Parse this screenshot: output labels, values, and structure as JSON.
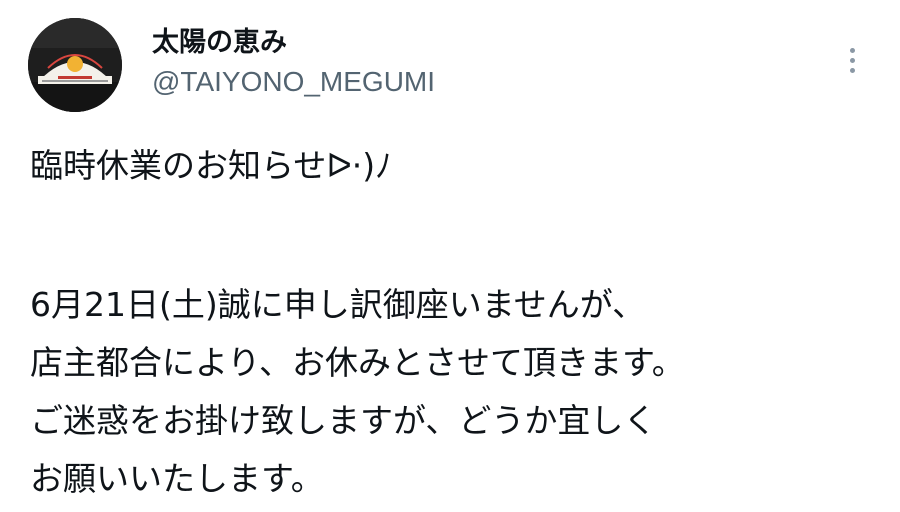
{
  "author": {
    "display_name": "太陽の恵み",
    "handle": "@TAIYONO_MEGUMI",
    "avatar_icon": "shop-sign-avatar-icon"
  },
  "menu": {
    "more_icon": "more-vertical-icon"
  },
  "tweet": {
    "heading": "臨時休業のお知らせᐅ·)ﾉ",
    "line1": "6月21日(土)誠に申し訳御座いませんが、",
    "line2": "店主都合により、お休みとさせて頂きます。",
    "line3": "ご迷惑をお掛け致しますが、どうか宜しく",
    "line4": "お願いいたします。"
  },
  "colors": {
    "text": "#0f1419",
    "secondary_text": "#536471",
    "background": "#ffffff"
  }
}
